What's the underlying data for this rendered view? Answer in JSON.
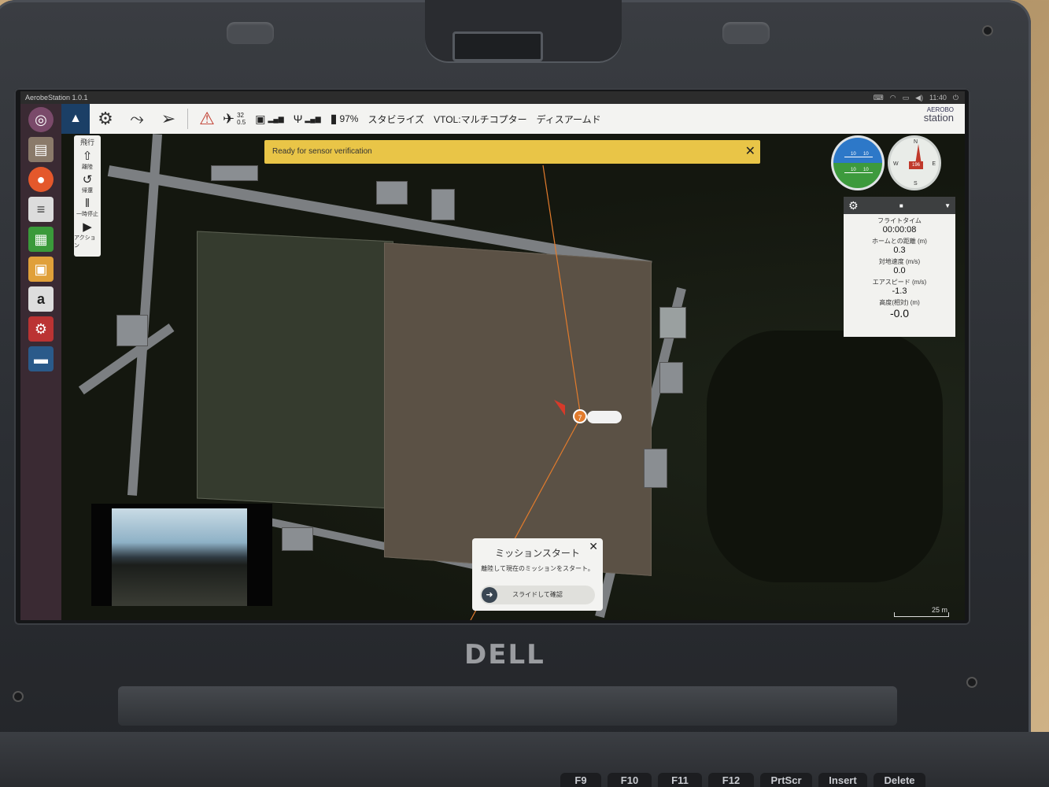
{
  "os": {
    "window_title": "AerobeStation 1.0.1",
    "clock": "11:40"
  },
  "toolbar": {
    "satellites": "32",
    "hdop": "0.5",
    "battery": "97%",
    "flight_mode": "スタビライズ",
    "vehicle_type": "VTOL:マルチコプター",
    "arm_state": "ディスアームド",
    "brand_top": "AEROBO",
    "brand_bottom": "station"
  },
  "notice": {
    "message": "Ready for sensor verification"
  },
  "action_panel": {
    "title": "飛行",
    "takeoff": "離陸",
    "return": "帰還",
    "pause": "一時停止",
    "action": "アクション"
  },
  "instruments": {
    "pitch_upper": "10",
    "pitch_lower": "10",
    "heading": "196",
    "compass_n": "N",
    "compass_e": "E",
    "compass_s": "S",
    "compass_w": "W"
  },
  "telemetry": {
    "rows": [
      {
        "label": "フライトタイム",
        "value": "00:00:08"
      },
      {
        "label": "ホームとの距離 (m)",
        "value": "0.3"
      },
      {
        "label": "対地速度 (m/s)",
        "value": "0.0"
      },
      {
        "label": "エアスピード (m/s)",
        "value": "-1.3"
      },
      {
        "label": "高度(相対) (m)",
        "value": "-0.0"
      }
    ]
  },
  "map": {
    "drone_id": "7",
    "scale": "25 m"
  },
  "mission": {
    "title": "ミッションスタート",
    "description": "離陸して現在のミッションをスタート。",
    "slider_label": "スライドして確認"
  },
  "laptop": {
    "brand": "DELL",
    "keys": [
      "F9",
      "F10",
      "F11",
      "F12",
      "PrtScr",
      "Insert",
      "Delete"
    ]
  }
}
